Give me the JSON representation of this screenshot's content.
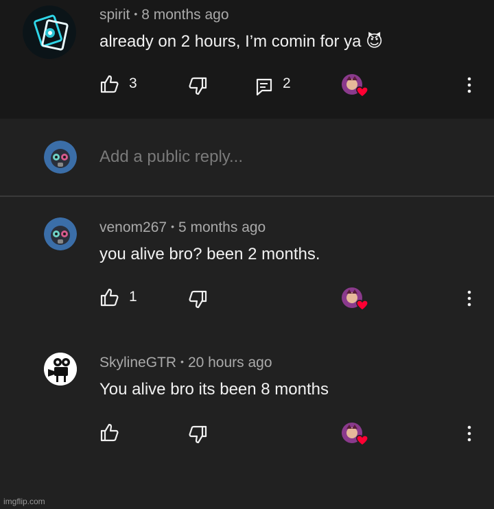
{
  "comments": [
    {
      "author": "spirit",
      "time": "8 months ago",
      "text": "already on 2 hours, I’m comin for ya 😈",
      "likes": "3",
      "replies": "2"
    },
    {
      "author": "venom267",
      "time": "5 months ago",
      "text": "you alive bro? been 2 months.",
      "likes": "1"
    },
    {
      "author": "SkylineGTR",
      "time": "20 hours ago",
      "text": "You alive bro its been 8 months",
      "likes": ""
    }
  ],
  "reply_box": {
    "placeholder": "Add a public reply..."
  },
  "watermark": "imgflip.com",
  "colors": {
    "background": "#212121",
    "top_background": "#181818",
    "heart": "#ff0033",
    "muted_text": "#aaaaaa"
  },
  "icons": [
    "thumbs-up-icon",
    "thumbs-down-icon",
    "reply-icon",
    "creator-heart-icon",
    "more-vert-icon"
  ]
}
